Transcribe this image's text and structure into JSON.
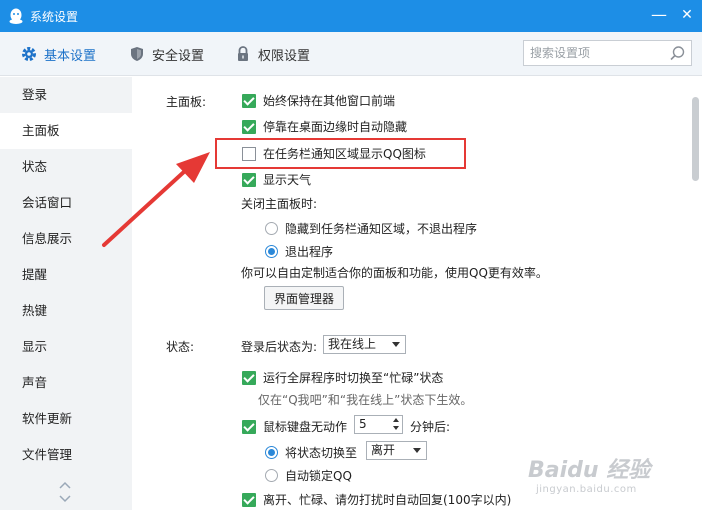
{
  "window": {
    "title": "系统设置",
    "minimize": "—",
    "close": "✕"
  },
  "tabs": [
    {
      "label": "基本设置",
      "icon": "gear-icon",
      "active": true
    },
    {
      "label": "安全设置",
      "icon": "shield-icon",
      "active": false
    },
    {
      "label": "权限设置",
      "icon": "lock-icon",
      "active": false
    }
  ],
  "search": {
    "placeholder": "搜索设置项"
  },
  "sidebar": {
    "items": [
      {
        "label": "登录"
      },
      {
        "label": "主面板",
        "active": true
      },
      {
        "label": "状态"
      },
      {
        "label": "会话窗口"
      },
      {
        "label": "信息展示"
      },
      {
        "label": "提醒"
      },
      {
        "label": "热键"
      },
      {
        "label": "显示"
      },
      {
        "label": "声音"
      },
      {
        "label": "软件更新"
      },
      {
        "label": "文件管理"
      }
    ]
  },
  "main_panel": {
    "label": "主面板:",
    "options": [
      {
        "label": "始终保持在其他窗口前端",
        "checked": true
      },
      {
        "label": "停靠在桌面边缘时自动隐藏",
        "checked": true
      },
      {
        "label": "在任务栏通知区域显示QQ图标",
        "checked": false
      },
      {
        "label": "显示天气",
        "checked": true
      }
    ],
    "close_label": "关闭主面板时:",
    "close_options": [
      {
        "label": "隐藏到任务栏通知区域，不退出程序",
        "checked": false
      },
      {
        "label": "退出程序",
        "checked": true
      }
    ],
    "customize_text": "你可以自由定制适合你的面板和功能，使用QQ更有效率。",
    "manager_button": "界面管理器"
  },
  "status": {
    "label": "状态:",
    "after_login_label": "登录后状态为:",
    "after_login_value": "我在线上",
    "fullscreen_option": {
      "label": "运行全屏程序时切换至“忙碌”状态",
      "checked": true
    },
    "fullscreen_hint": "仅在“Q我吧”和“我在线上”状态下生效。",
    "idle_option": {
      "label": "鼠标键盘无动作",
      "checked": true
    },
    "idle_minutes": "5",
    "idle_suffix": "分钟后:",
    "idle_actions": [
      {
        "label": "将状态切换至",
        "checked": true,
        "value": "离开"
      },
      {
        "label": "自动锁定QQ",
        "checked": false
      }
    ],
    "auto_reply_option": {
      "label": "离开、忙碌、请勿打扰时自动回复(100字以内)",
      "checked": true
    }
  },
  "watermark": {
    "logo": "Baidu 经验",
    "sub": "jingyan.baidu.com"
  },
  "colors": {
    "titlebar": "#1d8ee6",
    "accent": "#1d72c9",
    "check": "#36a95a",
    "annotation": "#e53935"
  }
}
